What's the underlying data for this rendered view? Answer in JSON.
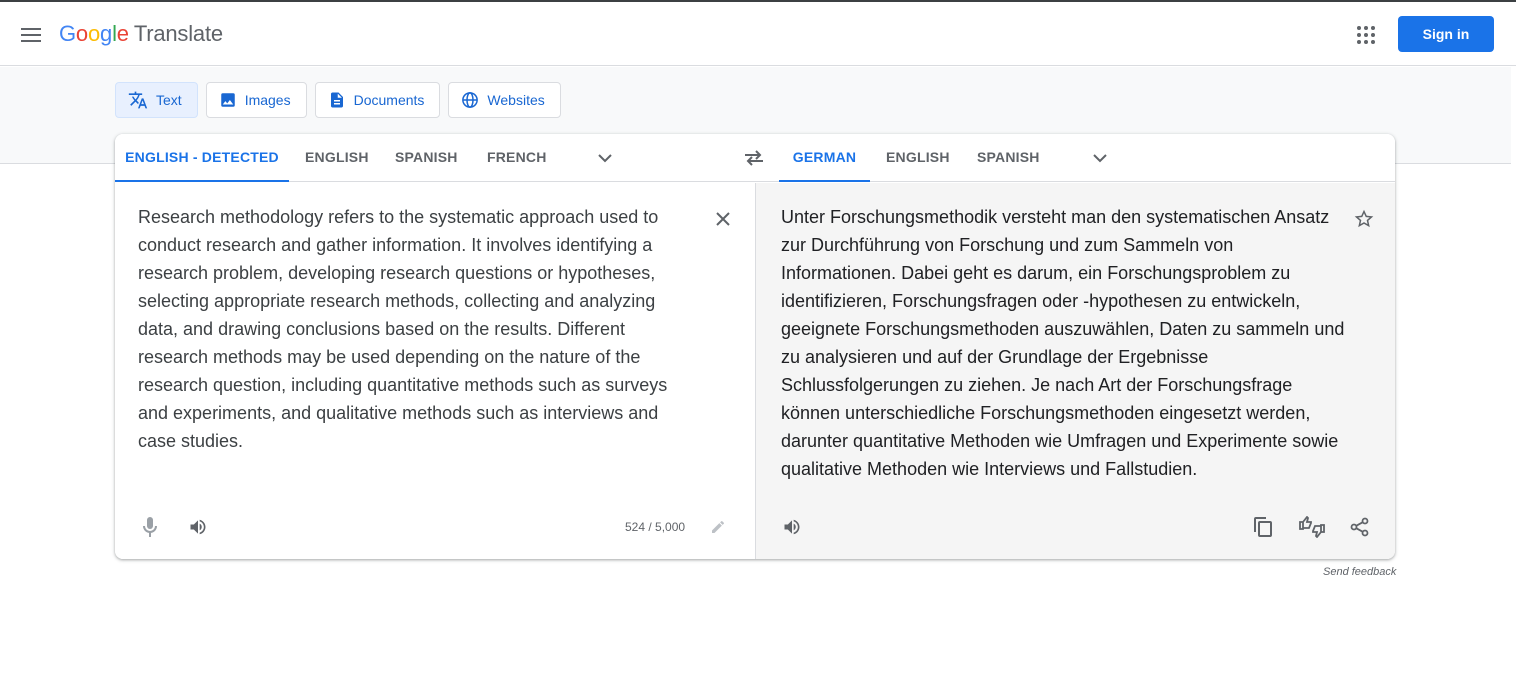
{
  "app": {
    "logo_letters": [
      "G",
      "o",
      "o",
      "g",
      "l",
      "e"
    ],
    "product": "Translate",
    "signin_label": "Sign in"
  },
  "modes": [
    {
      "label": "Text",
      "icon": "translate-icon",
      "active": true
    },
    {
      "label": "Images",
      "icon": "image-icon",
      "active": false
    },
    {
      "label": "Documents",
      "icon": "document-icon",
      "active": false
    },
    {
      "label": "Websites",
      "icon": "globe-icon",
      "active": false
    }
  ],
  "source": {
    "languages": [
      "ENGLISH - DETECTED",
      "ENGLISH",
      "SPANISH",
      "FRENCH"
    ],
    "active_language": "ENGLISH - DETECTED",
    "text": "Research methodology refers to the systematic approach used to conduct research and gather information. It involves identifying a research problem, developing research questions or hypotheses, selecting appropriate research methods, collecting and analyzing data, and drawing conclusions based on the results. Different research methods may be used depending on the nature of the research question, including quantitative methods such as surveys and experiments, and qualitative methods such as interviews and case studies.",
    "char_count": "524 / 5,000"
  },
  "target": {
    "languages": [
      "GERMAN",
      "ENGLISH",
      "SPANISH"
    ],
    "active_language": "GERMAN",
    "text": "Unter Forschungsmethodik versteht man den systematischen Ansatz zur Durchführung von Forschung und zum Sammeln von Informationen. Dabei geht es darum, ein Forschungsproblem zu identifizieren, Forschungsfragen oder -hypothesen zu entwickeln, geeignete Forschungsmethoden auszuwählen, Daten zu sammeln und zu analysieren und auf der Grundlage der Ergebnisse Schlussfolgerungen zu ziehen. Je nach Art der Forschungsfrage können unterschiedliche Forschungsmethoden eingesetzt werden, darunter quantitative Methoden wie Umfragen und Experimente sowie qualitative Methoden wie Interviews und Fallstudien."
  },
  "footer": {
    "feedback": "Send feedback"
  },
  "colors": {
    "accent": "#1a73e8",
    "brand_blue": "#4285f4",
    "brand_red": "#ea4335",
    "brand_yellow": "#fbbc05",
    "brand_green": "#34a853"
  }
}
